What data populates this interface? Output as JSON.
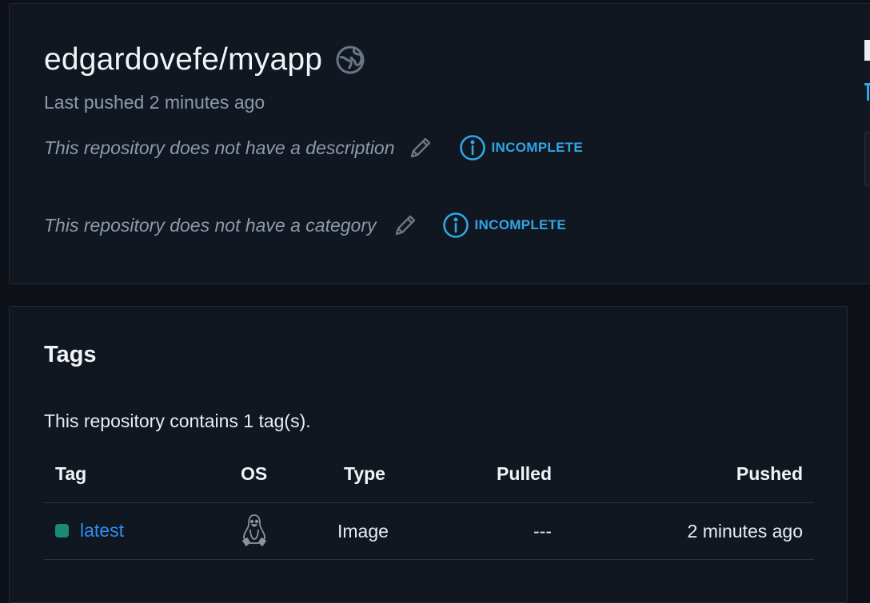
{
  "repo": {
    "name": "edgardovefe/myapp",
    "last_pushed": "Last pushed 2 minutes ago",
    "description_text": "This repository does not have a description",
    "category_text": "This repository does not have a category",
    "status_badge": "INCOMPLETE",
    "icons": {
      "visibility": "globe-icon",
      "edit": "pencil-icon",
      "status": "info-icon"
    }
  },
  "tags": {
    "title": "Tags",
    "count_text": "This repository contains 1 tag(s).",
    "columns": [
      "Tag",
      "OS",
      "Type",
      "Pulled",
      "Pushed"
    ],
    "rows": [
      {
        "tag": "latest",
        "os_icon": "linux-icon",
        "type": "Image",
        "pulled": "---",
        "pushed": "2 minutes ago",
        "status_color": "#1a8a77"
      }
    ]
  },
  "colors": {
    "accent": "#2fa6e8",
    "link": "#2f8cf0",
    "background": "#0d1117",
    "card": "#111720"
  }
}
